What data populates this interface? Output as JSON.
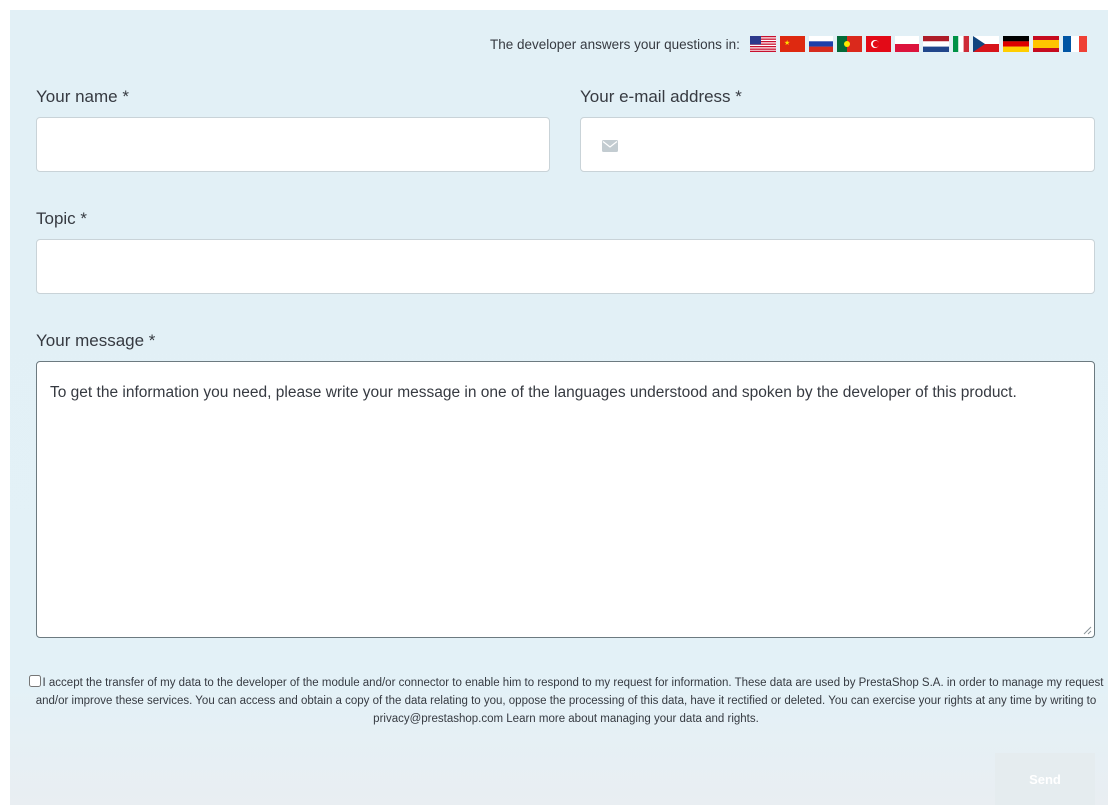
{
  "header": {
    "languages_text": "The developer answers your questions in:",
    "flags": [
      {
        "icon": "flag-us-icon"
      },
      {
        "icon": "flag-cn-icon"
      },
      {
        "icon": "flag-ru-icon"
      },
      {
        "icon": "flag-pt-icon"
      },
      {
        "icon": "flag-tr-icon"
      },
      {
        "icon": "flag-pl-icon"
      },
      {
        "icon": "flag-nl-icon"
      },
      {
        "icon": "flag-it-icon"
      },
      {
        "icon": "flag-cz-icon"
      },
      {
        "icon": "flag-de-icon"
      },
      {
        "icon": "flag-es-icon"
      },
      {
        "icon": "flag-fr-icon"
      }
    ]
  },
  "form": {
    "name_label": "Your name *",
    "name_value": "",
    "email_label": "Your e-mail address *",
    "email_value": "",
    "topic_label": "Topic *",
    "topic_value": "",
    "message_label": "Your message *",
    "message_value": "To get the information you need, please write your message in one of the languages understood and spoken by the developer of this product.",
    "consent_text": "I accept the transfer of my data to the developer of the module and/or connector to enable him to respond to my request for information. These data are used by PrestaShop S.A. in order to manage my request and/or improve these services. You can access and obtain a copy of the data relating to you, oppose the processing of this data, have it rectified or deleted. You can exercise your rights at any time by writing to privacy@prestashop.com Learn more about managing your data and rights.",
    "consent_checked": false,
    "send_label": "Send"
  },
  "colors": {
    "panel_bg": "#e2f0f6",
    "send_disabled_bg": "#e5ecef"
  }
}
